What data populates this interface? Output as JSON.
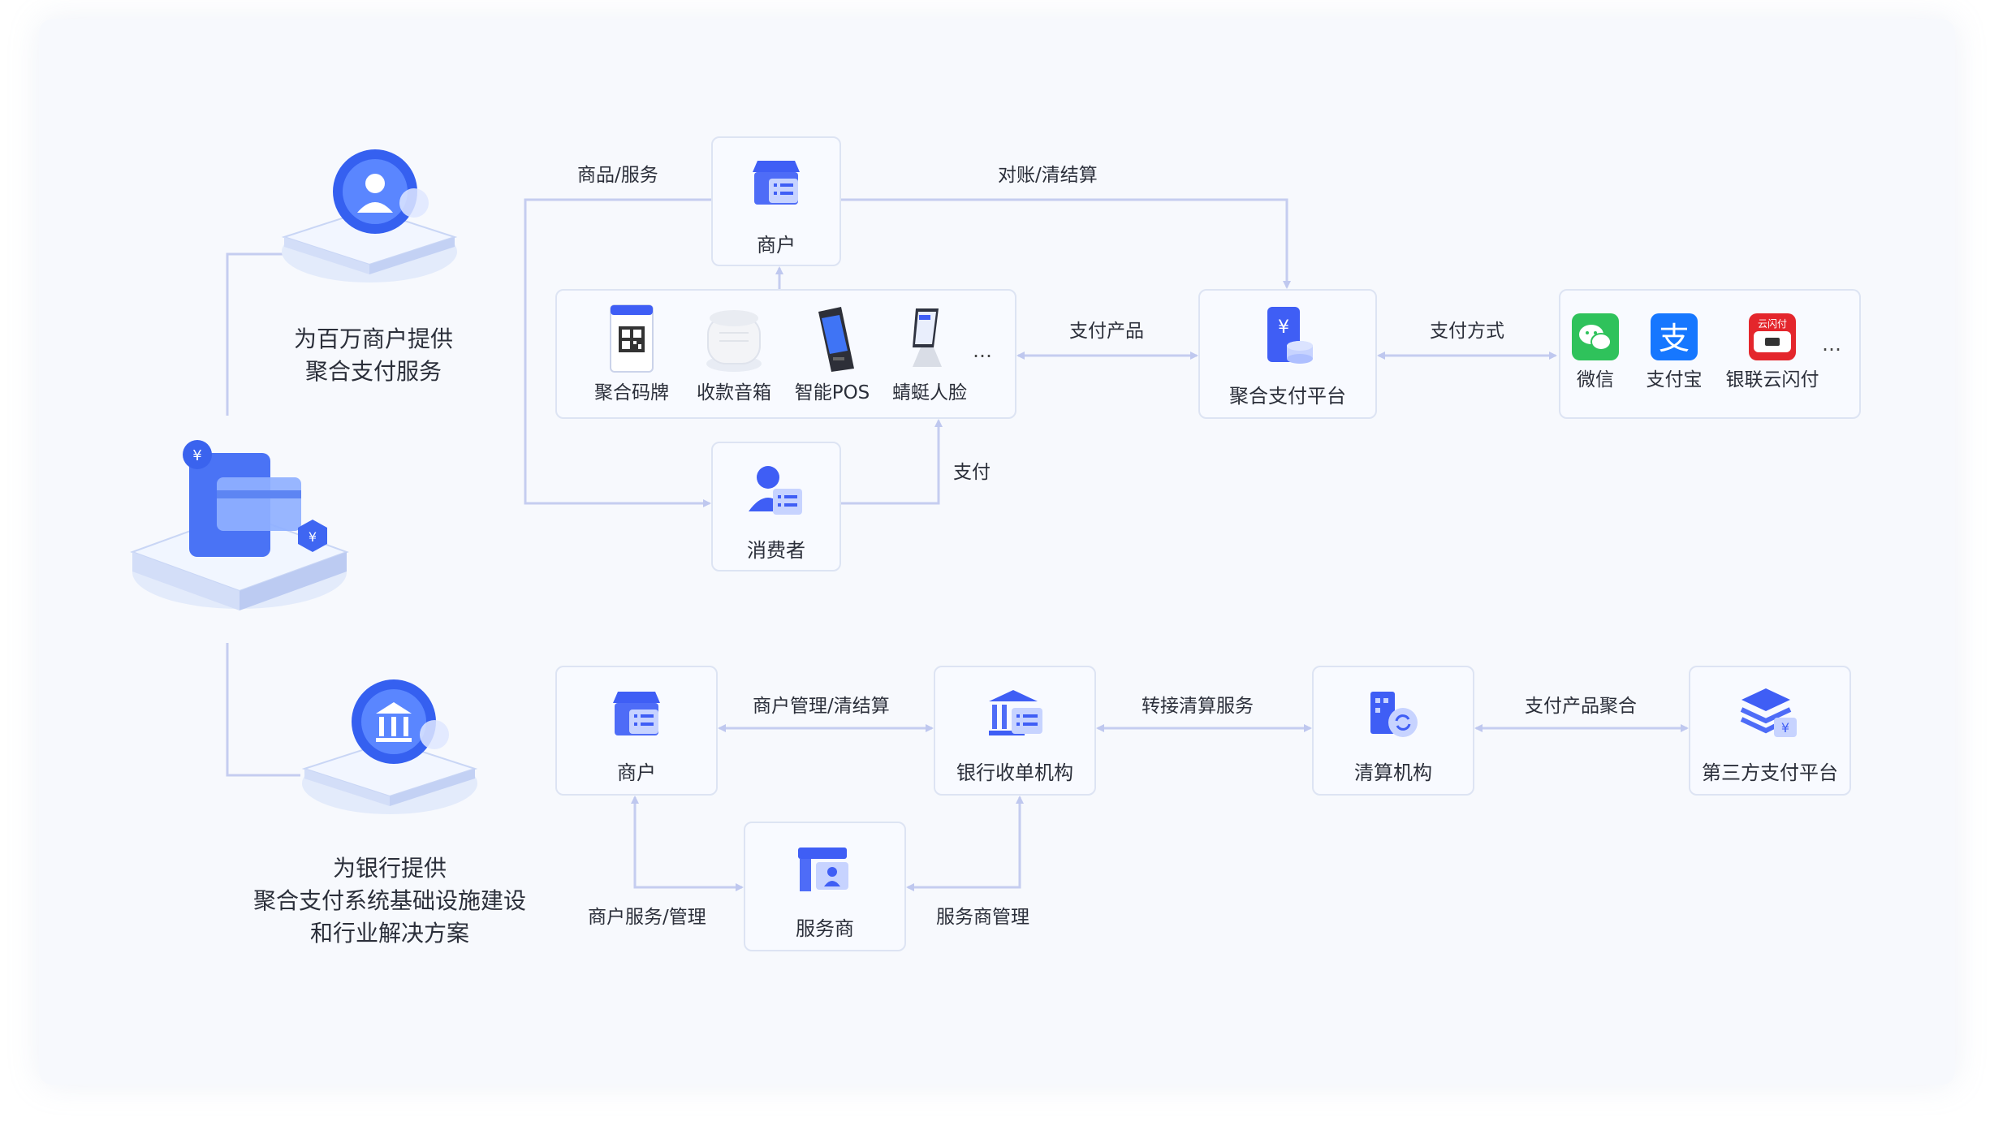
{
  "top": {
    "description": [
      "为百万商户提供",
      "聚合支付服务"
    ],
    "merchant": "商户",
    "consumer": "消费者",
    "devices": [
      "聚合码牌",
      "收款音箱",
      "智能POS",
      "蜻蜓人脸"
    ],
    "platform": "聚合支付平台",
    "payments": [
      "微信",
      "支付宝",
      "银联云闪付"
    ],
    "more": "…",
    "edges": {
      "goods_services": "商品/服务",
      "reconciliation": "对账/清结算",
      "payment_product": "支付产品",
      "payment_method": "支付方式",
      "pay": "支付"
    }
  },
  "bottom": {
    "description": [
      "为银行提供",
      "聚合支付系统基础设施建设",
      "和行业解决方案"
    ],
    "merchant": "商户",
    "bank": "银行收单机构",
    "clearing": "清算机构",
    "third_party": "第三方支付平台",
    "service_provider": "服务商",
    "edges": {
      "merchant_mgmt": "商户管理/清结算",
      "transfer_clearing": "转接清算服务",
      "product_aggregation": "支付产品聚合",
      "merchant_service": "商户服务/管理",
      "sp_mgmt": "服务商管理"
    }
  },
  "colors": {
    "accent": "#3f5ef5",
    "line": "#c5cdf0",
    "wechat": "#2fc25b",
    "alipay": "#1677ff",
    "unionpay": "#e4262c"
  }
}
